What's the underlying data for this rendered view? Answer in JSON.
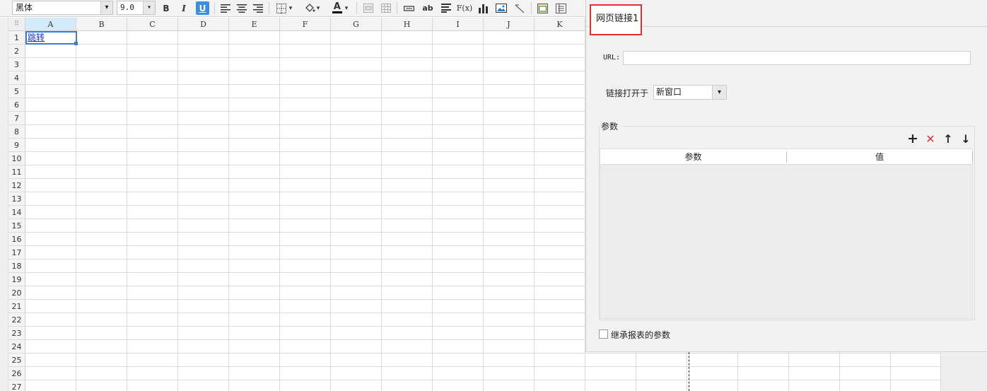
{
  "toolbar": {
    "font_value": "黑体",
    "size_value": "9.0",
    "bold_label": "B",
    "italic_label": "I",
    "underline_label": "U",
    "font_color_label": "A",
    "text_btn_label": "ab",
    "formula_label": "F(x)"
  },
  "sheet": {
    "columns": [
      "A",
      "B",
      "C",
      "D",
      "E",
      "F",
      "G",
      "H",
      "I",
      "J",
      "K"
    ],
    "rows": [
      "1",
      "2",
      "3",
      "4",
      "5",
      "6",
      "7",
      "8",
      "9",
      "10",
      "11",
      "12",
      "13",
      "14",
      "15",
      "16",
      "17",
      "18",
      "19",
      "20",
      "21",
      "22",
      "23",
      "24",
      "25",
      "26",
      "27"
    ],
    "cell_a1": "跳转",
    "corner_glyph": "⠿"
  },
  "dialog": {
    "tab_label": "网页链接1",
    "url_label": "URL:",
    "url_value": "",
    "open_in_label": "链接打开于",
    "open_in_value": "新窗口",
    "params_group_label": "参数",
    "add_icon": "+",
    "delete_icon": "✕",
    "up_icon": "↑",
    "down_icon": "↓",
    "col_param": "参数",
    "col_value": "值",
    "inherit_label": "继承报表的参数"
  },
  "colors": {
    "accent": "#3a7fd0",
    "highlight_border": "#e03030",
    "delete_red": "#e03030",
    "link_blue": "#1a2fd0"
  }
}
